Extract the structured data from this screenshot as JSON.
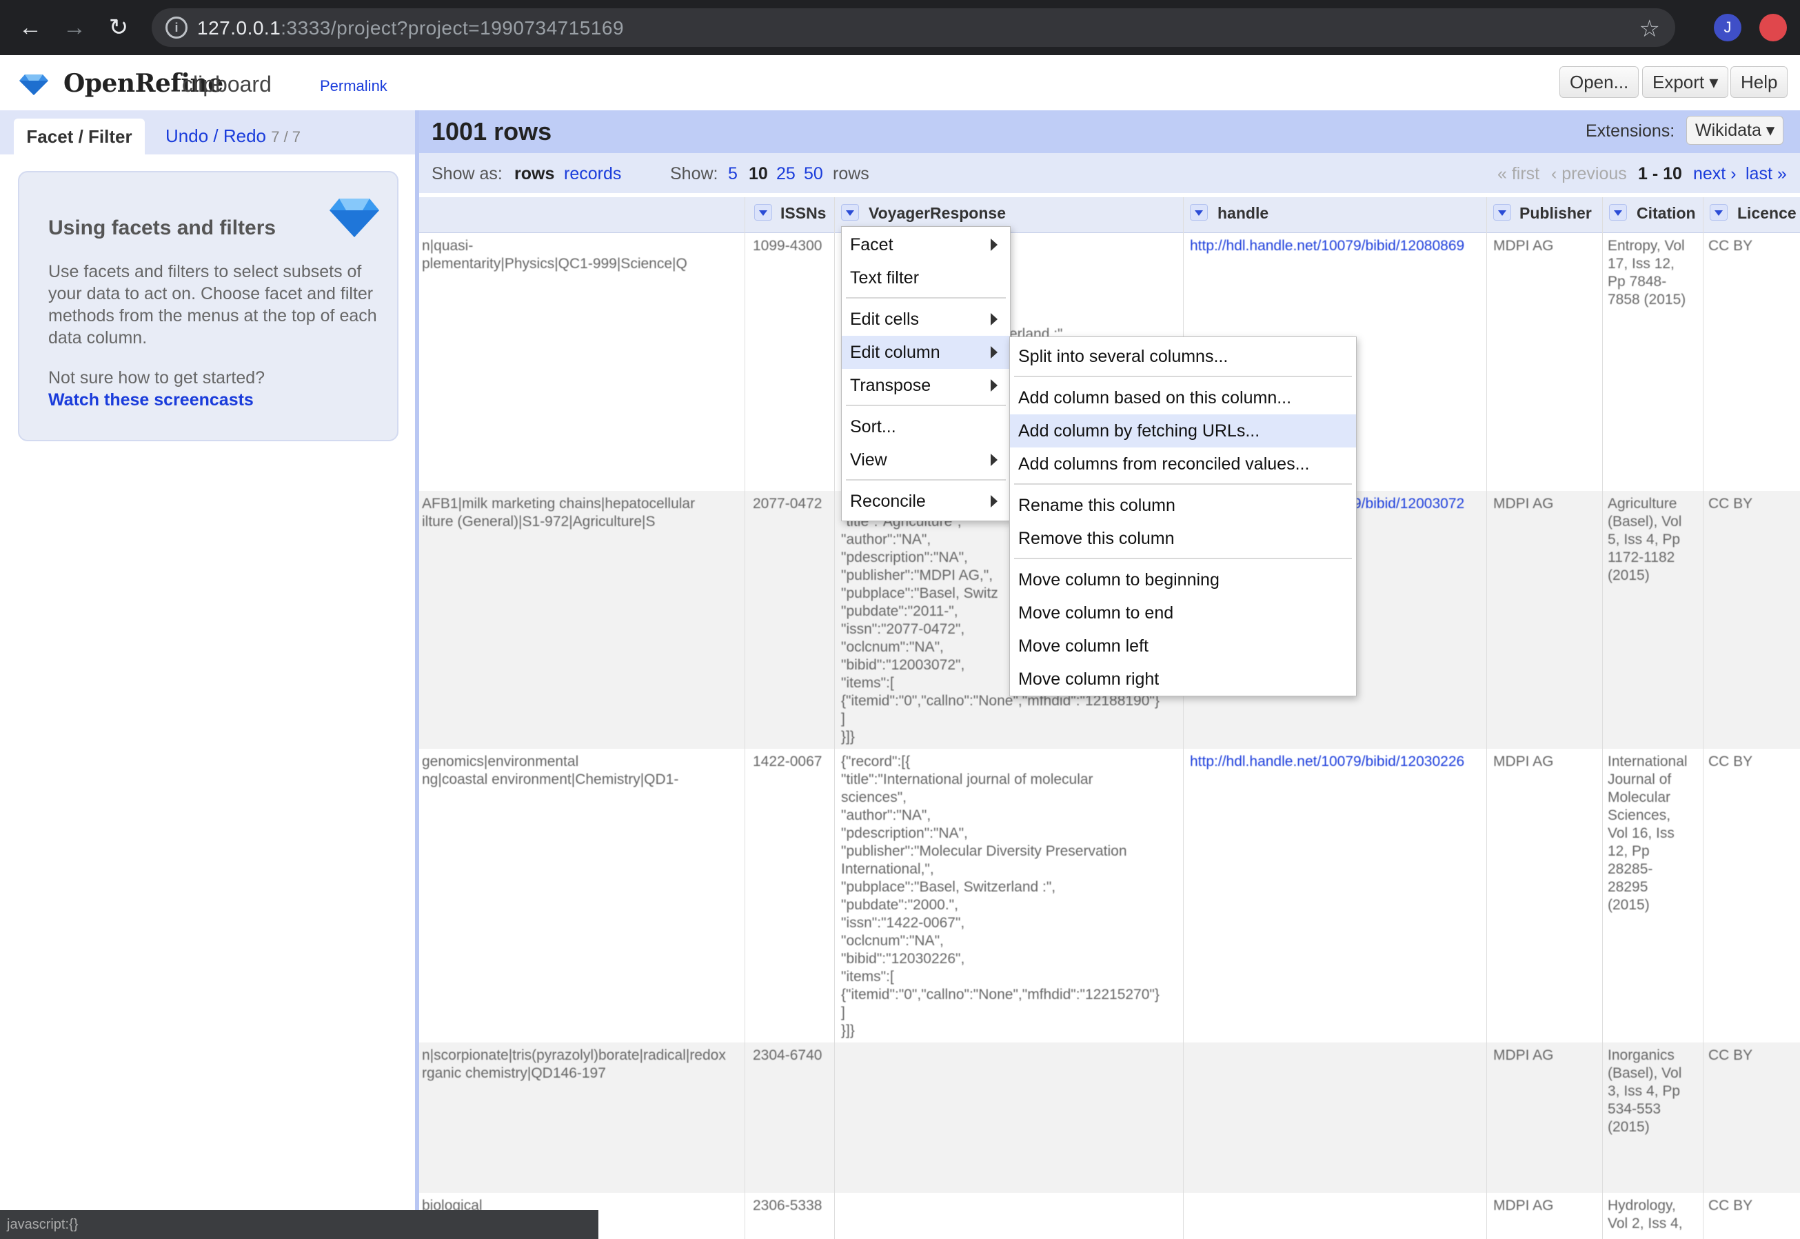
{
  "browser": {
    "url_host": "127.0.0.1",
    "url_rest": ":3333/project?project=1990734715169",
    "avatar_letter": "J"
  },
  "app": {
    "name": "OpenRefine",
    "project": "clipboard",
    "permalink": "Permalink",
    "buttons": {
      "open": "Open...",
      "export": "Export ▾",
      "help": "Help"
    }
  },
  "left": {
    "tab_facet": "Facet / Filter",
    "tab_undo": "Undo / Redo",
    "undo_count": "7 / 7",
    "card_title": "Using facets and filters",
    "card_body": "Use facets and filters to select subsets of your data to act on. Choose facet and filter methods from the menus at the top of each data column.",
    "card_question": "Not sure how to get started?",
    "card_link": "Watch these screencasts"
  },
  "main": {
    "row_count": "1001 rows",
    "extensions_label": "Extensions:",
    "extensions_value": "Wikidata ▾",
    "show_as": "Show as:",
    "mode_rows": "rows",
    "mode_records": "records",
    "show": "Show:",
    "page_sizes": [
      "5",
      "10",
      "25",
      "50"
    ],
    "rows_word": "rows",
    "pager": {
      "first": "« first",
      "previous": "‹ previous",
      "range": "1 - 10",
      "next": "next ›",
      "last": "last »"
    }
  },
  "table": {
    "headers": [
      "ISSNs",
      "VoyagerResponse",
      "handle",
      "Publisher",
      "Citation",
      "Licence"
    ],
    "rows": [
      {
        "subjects": "n|quasi-\nplementarity|Physics|QC1-999|Science|Q",
        "issn": "1099-4300",
        "voyager": "",
        "handle": "http://hdl.handle.net/10079/bibid/12080869",
        "publisher": "MDPI AG",
        "citation": "Entropy, Vol\n17, Iss 12,\nPp 7848-\n7858 (2015)",
        "licence": "CC BY"
      },
      {
        "subjects": "AFB1|milk marketing chains|hepatocellular\nilture (General)|S1-972|Agriculture|S",
        "issn": "2077-0472",
        "voyager": "\"title\":\"Agriculture\",\n\"author\":\"NA\",\n\"pdescription\":\"NA\",\n\"publisher\":\"MDPI AG,\",\n\"pubplace\":\"Basel, Switz\n\"pubdate\":\"2011-\",\n\"issn\":\"2077-0472\",\n\"oclcnum\":\"NA\",\n\"bibid\":\"12003072\",\n\"items\":[\n{\"itemid\":\"0\",\"callno\":\"None\",\"mfhdid\":\"12188190\"}\n]\n}]}",
        "handle": "http://hdl.handle.net/10079/bibid/12003072",
        "publisher": "MDPI AG",
        "citation": "Agriculture\n(Basel), Vol\n5, Iss 4, Pp\n1172-1182\n(2015)",
        "licence": "CC BY"
      },
      {
        "subjects": "genomics|environmental\nng|coastal environment|Chemistry|QD1-",
        "issn": "1422-0067",
        "voyager": "{\"record\":[{\n\"title\":\"International journal of molecular\nsciences\",\n\"author\":\"NA\",\n\"pdescription\":\"NA\",\n\"publisher\":\"Molecular Diversity Preservation\nInternational,\",\n\"pubplace\":\"Basel, Switzerland :\",\n\"pubdate\":\"2000.\",\n\"issn\":\"1422-0067\",\n\"oclcnum\":\"NA\",\n\"bibid\":\"12030226\",\n\"items\":[\n{\"itemid\":\"0\",\"callno\":\"None\",\"mfhdid\":\"12215270\"}\n]\n}]}",
        "handle": "http://hdl.handle.net/10079/bibid/12030226",
        "publisher": "MDPI AG",
        "citation": "International\nJournal of\nMolecular\nSciences,\nVol 16, Iss\n12, Pp\n28285-\n28295\n(2015)",
        "licence": "CC BY"
      },
      {
        "subjects": "n|scorpionate|tris(pyrazolyl)borate|radical|redox\nrganic chemistry|QD146-197",
        "issn": "2304-6740",
        "voyager": "",
        "handle": "",
        "publisher": "MDPI AG",
        "citation": "Inorganics\n(Basel), Vol\n3, Iss 4, Pp\n534-553\n(2015)",
        "licence": "CC BY"
      },
      {
        "subjects": "biological\nnce|Q",
        "issn": "2306-5338",
        "voyager": "",
        "handle": "",
        "publisher": "MDPI AG",
        "citation": "Hydrology,\nVol 2, Iss 4,",
        "licence": "CC BY"
      }
    ],
    "partial_text": "erland :\""
  },
  "status_text": "javascript:{}",
  "menu": {
    "items": [
      "Facet",
      "Text filter",
      "Edit cells",
      "Edit column",
      "Transpose",
      "Sort...",
      "View",
      "Reconcile"
    ]
  },
  "submenu": {
    "items": [
      "Split into several columns...",
      "Add column based on this column...",
      "Add column by fetching URLs...",
      "Add columns from reconciled values...",
      "Rename this column",
      "Remove this column",
      "Move column to beginning",
      "Move column to end",
      "Move column left",
      "Move column right"
    ]
  },
  "colors": {
    "accent": "#1a3cdb",
    "header_band": "#bfcdf6",
    "menu_highlight": "#dfe7fb"
  }
}
